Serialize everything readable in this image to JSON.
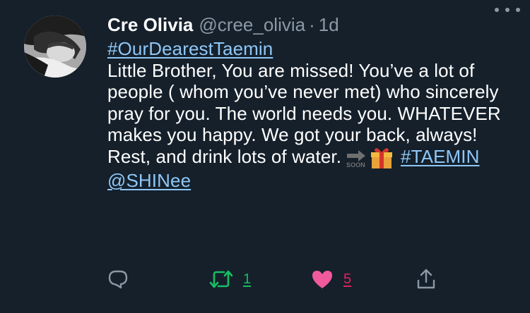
{
  "tweet": {
    "display_name": "Cre Olivia",
    "handle": "@cree_olivia",
    "separator": "·",
    "time": "1d",
    "hashtag_top": "#OurDearestTaemin",
    "text_main": "Little Brother, You are missed! You’ve a lot of people ( whom you’ve never met) who sincerely pray for you. The world needs you. WHATEVER makes you happy. We got your back, always! Rest, and drink lots of water.",
    "emoji_soon_label": "SOON",
    "hashtag_end": "#TAEMIN",
    "mention": "@SHINee"
  },
  "actions": {
    "reply_icon": "reply-icon",
    "retweet_icon": "retweet-icon",
    "retweet_count": "1",
    "like_icon": "heart-icon",
    "like_count": "5",
    "share_icon": "share-icon"
  },
  "colors": {
    "background": "#15202b",
    "link": "#8ec7f7",
    "secondary_text": "#8b98a5",
    "retweet_green": "#17bf63",
    "like_pink": "#e0245e"
  }
}
